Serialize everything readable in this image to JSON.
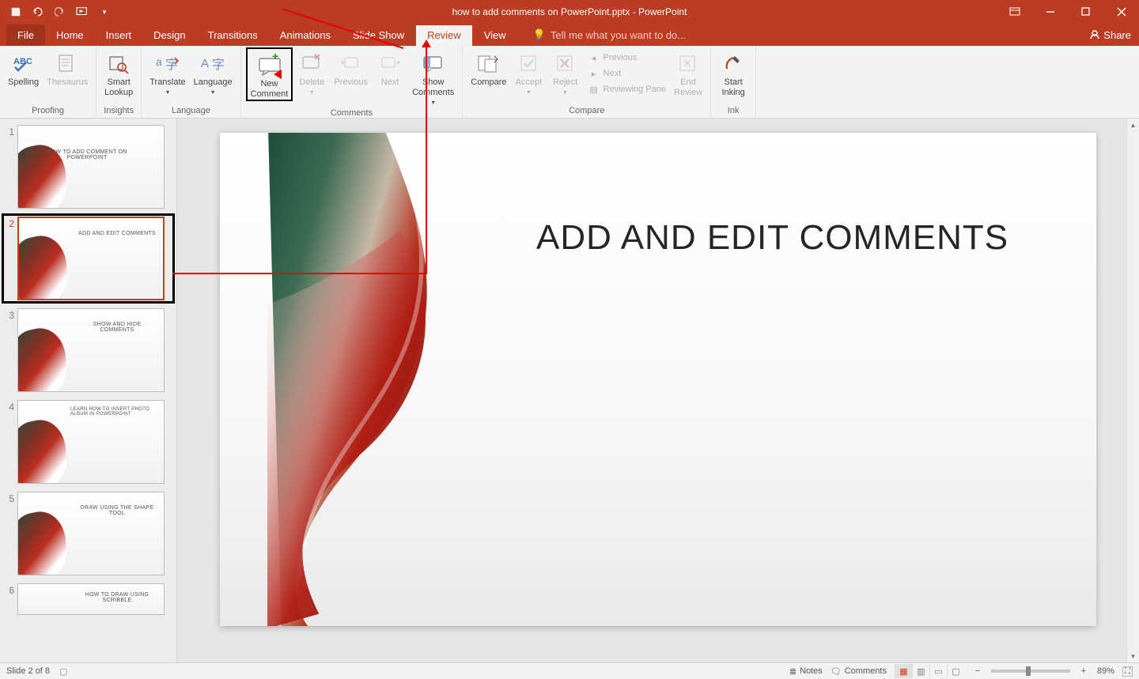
{
  "titlebar": {
    "document_title": "how to add comments on PowerPoint.pptx - PowerPoint"
  },
  "tabs": {
    "file": "File",
    "home": "Home",
    "insert": "Insert",
    "design": "Design",
    "transitions": "Transitions",
    "animations": "Animations",
    "slideshow": "Slide Show",
    "review": "Review",
    "view": "View",
    "tellme": "Tell me what you want to do...",
    "share": "Share"
  },
  "ribbon": {
    "proofing": {
      "spelling": "Spelling",
      "thesaurus": "Thesaurus",
      "label": "Proofing"
    },
    "insights": {
      "smart_lookup": "Smart\nLookup",
      "label": "Insights"
    },
    "language": {
      "translate": "Translate",
      "language": "Language",
      "label": "Language"
    },
    "comments": {
      "new_comment": "New\nComment",
      "delete": "Delete",
      "previous": "Previous",
      "next": "Next",
      "show_comments": "Show\nComments",
      "label": "Comments"
    },
    "compare": {
      "compare": "Compare",
      "accept": "Accept",
      "reject": "Reject",
      "previous": "Previous",
      "next": "Next",
      "reviewing_pane": "Reviewing Pane",
      "end_review": "End\nReview",
      "label": "Compare"
    },
    "ink": {
      "start_inking": "Start\nInking",
      "label": "Ink"
    }
  },
  "thumbs": [
    {
      "n": "1",
      "title": "HOW TO ADD COMMENT ON POWERPOINT"
    },
    {
      "n": "2",
      "title": "ADD AND EDIT COMMENTS"
    },
    {
      "n": "3",
      "title": "SHOW AND HIDE COMMENTS"
    },
    {
      "n": "4",
      "title": "LEARN HOW TO INSERT PHOTO ALBUM IN POWERPOINT"
    },
    {
      "n": "5",
      "title": "DRAW USING THE SHAPE TOOL"
    },
    {
      "n": "6",
      "title": "HOW TO DRAW USING SCRIBBLE"
    }
  ],
  "slide": {
    "title": "ADD AND EDIT COMMENTS"
  },
  "status": {
    "slide_pos": "Slide 2 of 8",
    "notes": "Notes",
    "comments": "Comments",
    "zoom": "89%"
  }
}
